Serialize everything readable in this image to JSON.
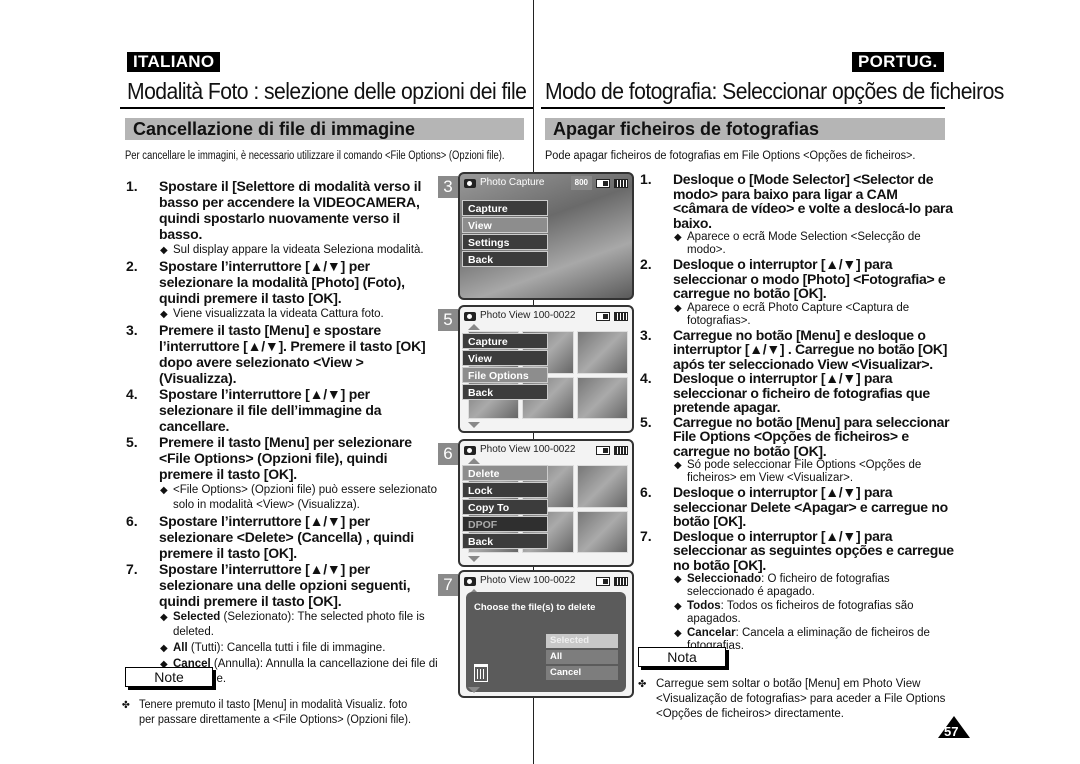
{
  "left": {
    "language": "ITALIANO",
    "title": "Modalità Foto : selezione delle opzioni dei file",
    "section": "Cancellazione di file di immagine",
    "intro": "Per cancellare le immagini, è necessario utilizzare il comando <File Options> (Opzioni file).",
    "steps": [
      {
        "num": "1.",
        "text": "Spostare il [Selettore di modalità verso il basso per accendere la VIDEOCAMERA, quindi spostarlo nuovamente verso il basso.",
        "bullets": [
          {
            "bold": "",
            "text": "Sul display appare la videata Seleziona modalità."
          }
        ]
      },
      {
        "num": "2.",
        "text": "Spostare l’interruttore [▲/▼] per selezionare la modalità [Photo] (Foto), quindi premere il tasto [OK].",
        "bullets": [
          {
            "bold": "",
            "text": "Viene visualizzata la videata Cattura foto."
          }
        ]
      },
      {
        "num": "3.",
        "text": "Premere il tasto [Menu] e spostare l’interruttore [▲/▼]. Premere il tasto [OK] dopo avere selezionato <View > (Visualizza).",
        "bullets": []
      },
      {
        "num": "4.",
        "text": "Spostare l’interruttore [▲/▼] per selezionare il file dell’immagine da cancellare.",
        "bullets": []
      },
      {
        "num": "5.",
        "text": "Premere il tasto [Menu] per selezionare <File Options> (Opzioni file), quindi premere il tasto [OK].",
        "bullets": [
          {
            "bold": "",
            "text": "<File Options> (Opzioni file) può essere selezionato solo in modalità <View> (Visualizza)."
          }
        ]
      },
      {
        "num": "6.",
        "text": "Spostare l’interruttore [▲/▼] per selezionare <Delete> (Cancella) , quindi premere il tasto [OK].",
        "bullets": []
      },
      {
        "num": "7.",
        "text": "Spostare l’interruttore [▲/▼] per selezionare una delle opzioni seguenti, quindi premere il tasto [OK].",
        "bullets": [
          {
            "bold": "Selected",
            "text": " (Selezionato): The selected photo file is deleted."
          },
          {
            "bold": "All",
            "text": " (Tutti): Cancella tutti i file di immagine."
          },
          {
            "bold": "Cancel",
            "text": " (Annulla): Annulla la cancellazione dei file di immagine."
          }
        ]
      }
    ],
    "note_label": "Note",
    "note_text": "Tenere premuto il tasto [Menu] in modalità Visualiz. foto per passare direttamente a <File Options> (Opzioni file)."
  },
  "right": {
    "language": "PORTUG.",
    "title": "Modo de fotografia: Seleccionar opções de ficheiros",
    "section": "Apagar ficheiros de fotografias",
    "intro": "Pode apagar ficheiros de fotografias em File Options <Opções de ficheiros>.",
    "steps": [
      {
        "num": "1.",
        "text": "Desloque o [Mode Selector] <Selector de modo> para baixo para ligar a CAM <câmara de vídeo> e volte a deslocá-lo para baixo.",
        "bullets": [
          {
            "bold": "",
            "text": "Aparece o ecrã Mode Selection <Selecção de modo>."
          }
        ]
      },
      {
        "num": "2.",
        "text": "Desloque o interruptor [▲/▼] para seleccionar o modo [Photo] <Fotografia> e carregue no botão [OK].",
        "bullets": [
          {
            "bold": "",
            "text": "Aparece o ecrã Photo Capture <Captura de fotografias>."
          }
        ]
      },
      {
        "num": "3.",
        "text": "Carregue no botão [Menu] e desloque o interruptor [▲/▼] . Carregue no botão [OK] após ter seleccionado View <Visualizar>.",
        "bullets": []
      },
      {
        "num": "4.",
        "text": "Desloque o interruptor [▲/▼] para seleccionar o ficheiro de fotografias que pretende apagar.",
        "bullets": []
      },
      {
        "num": "5.",
        "text": "Carregue no botão [Menu] para seleccionar File Options <Opções de ficheiros> e carregue no botão [OK].",
        "bullets": [
          {
            "bold": "",
            "text": "Só pode seleccionar File Options <Opções de ficheiros> em View <Visualizar>."
          }
        ]
      },
      {
        "num": "6.",
        "text": "Desloque o interruptor [▲/▼] para seleccionar Delete <Apagar> e carregue no botão [OK].",
        "bullets": []
      },
      {
        "num": "7.",
        "text": "Desloque o interruptor [▲/▼] para seleccionar as seguintes opções e carregue no botão [OK].",
        "bullets": [
          {
            "bold": "Seleccionado",
            "text": ": O ficheiro de fotografias seleccionado é apagado."
          },
          {
            "bold": "Todos",
            "text": ": Todos os ficheiros de fotografias são apagados."
          },
          {
            "bold": "Cancelar",
            "text": ": Cancela a eliminação de ficheiros de fotografias."
          }
        ]
      }
    ],
    "note_label": "Nota",
    "note_text": "Carregue sem soltar o botão [Menu] em Photo View <Visualização de fotografias> para aceder a File Options <Opções de ficheiros> directamente."
  },
  "screens": [
    {
      "num": "3",
      "header": "Photo Capture",
      "badge": "800",
      "menu": [
        {
          "label": "Capture",
          "state": ""
        },
        {
          "label": "View",
          "state": "sel"
        },
        {
          "label": "Settings",
          "state": ""
        },
        {
          "label": "Back",
          "state": ""
        }
      ]
    },
    {
      "num": "5",
      "header": "Photo View  100-0022",
      "menu": [
        {
          "label": "Capture",
          "state": ""
        },
        {
          "label": "View",
          "state": ""
        },
        {
          "label": "File Options",
          "state": "sel"
        },
        {
          "label": "Back",
          "state": ""
        }
      ]
    },
    {
      "num": "6",
      "header": "Photo View  100-0022",
      "menu": [
        {
          "label": "Delete",
          "state": "sel"
        },
        {
          "label": "Lock",
          "state": ""
        },
        {
          "label": "Copy To",
          "state": ""
        },
        {
          "label": "DPOF",
          "state": "dim"
        },
        {
          "label": "Back",
          "state": ""
        }
      ]
    },
    {
      "num": "7",
      "header": "Photo View  100-0022",
      "dialog": {
        "title": "Choose the file(s) to delete",
        "options": [
          {
            "label": "Selected",
            "state": "sel"
          },
          {
            "label": "All",
            "state": ""
          },
          {
            "label": "Cancel",
            "state": ""
          }
        ]
      }
    }
  ],
  "page_number": "57",
  "icons": {
    "bullet": "◆",
    "note_bullet": "✤"
  }
}
